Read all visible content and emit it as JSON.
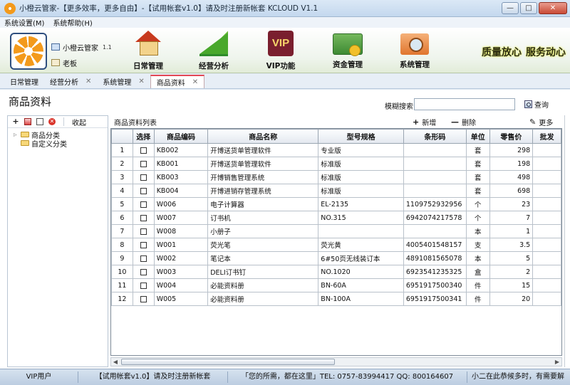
{
  "window": {
    "title": "小橙云管家-【更多效率，更多自由】-【试用帐套v1.0】请及时注册新帐套  KCLOUD V1.1",
    "min_label": "—",
    "max_label": "□",
    "close_label": "✕"
  },
  "menu": [
    "系统设置(M)",
    "系统帮助(H)"
  ],
  "user": {
    "app_name": "小橙云管家",
    "version": "1.1",
    "role": "老板"
  },
  "toolbar": [
    {
      "label": "日常管理",
      "icon": "house-icon"
    },
    {
      "label": "经营分析",
      "icon": "chart-icon"
    },
    {
      "label": "VIP功能",
      "icon": "vip-icon",
      "icon_text": "VIP"
    },
    {
      "label": "资金管理",
      "icon": "money-icon"
    },
    {
      "label": "系统管理",
      "icon": "folder-icon"
    }
  ],
  "slogans": [
    "质量放心",
    "服务动心"
  ],
  "tabs": [
    {
      "label": "日常管理",
      "closable": false
    },
    {
      "label": "经营分析",
      "closable": true
    },
    {
      "label": "系统管理",
      "closable": true
    },
    {
      "label": "商品资料",
      "closable": true,
      "active": true
    }
  ],
  "tab_close_glyph": "✕",
  "page": {
    "title": "商品资料",
    "search_label": "模糊搜索",
    "search_value": "",
    "query_label": "查询"
  },
  "left_panel": {
    "add_glyph": "+",
    "delete_glyph": "✕",
    "collapse_label": "收起",
    "tree": [
      {
        "label": "商品分类",
        "expander": "▷"
      },
      {
        "label": "自定义分类",
        "expander": ""
      }
    ]
  },
  "right_panel": {
    "title": "商品资料列表",
    "add_label": "新增",
    "delete_label": "删除",
    "more_label": "更多",
    "add_glyph": "+",
    "delete_glyph": "—",
    "more_glyph": "✎"
  },
  "table": {
    "columns": [
      "",
      "选择",
      "商品编码",
      "商品名称",
      "型号规格",
      "条形码",
      "单位",
      "零售价",
      "批发"
    ],
    "rows": [
      [
        "1",
        "",
        "KB002",
        "开博送货单管理软件",
        "专业版",
        "",
        "套",
        "298",
        ""
      ],
      [
        "2",
        "",
        "KB001",
        "开博送货单管理软件",
        "标准版",
        "",
        "套",
        "198",
        ""
      ],
      [
        "3",
        "",
        "KB003",
        "开博销售管理系统",
        "标准版",
        "",
        "套",
        "498",
        ""
      ],
      [
        "4",
        "",
        "KB004",
        "开博进销存管理系统",
        "标准版",
        "",
        "套",
        "698",
        ""
      ],
      [
        "5",
        "",
        "W006",
        "电子计算器",
        "EL-2135",
        "1109752932956",
        "个",
        "23",
        ""
      ],
      [
        "6",
        "",
        "W007",
        "订书机",
        "NO.315",
        "6942074217578",
        "个",
        "7",
        ""
      ],
      [
        "7",
        "",
        "W008",
        "小册子",
        "",
        "",
        "本",
        "1",
        ""
      ],
      [
        "8",
        "",
        "W001",
        "荧光笔",
        "荧光黄",
        "4005401548157",
        "支",
        "3.5",
        ""
      ],
      [
        "9",
        "",
        "W002",
        "笔记本",
        "6#50页无线装订本",
        "4891081565078",
        "本",
        "5",
        ""
      ],
      [
        "10",
        "",
        "W003",
        "DELI订书钉",
        "NO.1020",
        "6923541235325",
        "盒",
        "2",
        ""
      ],
      [
        "11",
        "",
        "W004",
        "必能资料册",
        "BN-60A",
        "6951917500340",
        "件",
        "15",
        ""
      ],
      [
        "12",
        "",
        "W005",
        "必能资料册",
        "BN-100A",
        "6951917500341",
        "件",
        "20",
        ""
      ]
    ]
  },
  "scroll": {
    "left_arrow": "◀",
    "right_arrow": "▶"
  },
  "status": [
    "VIP用户",
    "【试用帐套v1.0】请及时注册新帐套",
    "「您的所需，都在这里」TEL: 0757-83994417  QQ: 800164607",
    "小二在此恭候多时，有需要解"
  ]
}
